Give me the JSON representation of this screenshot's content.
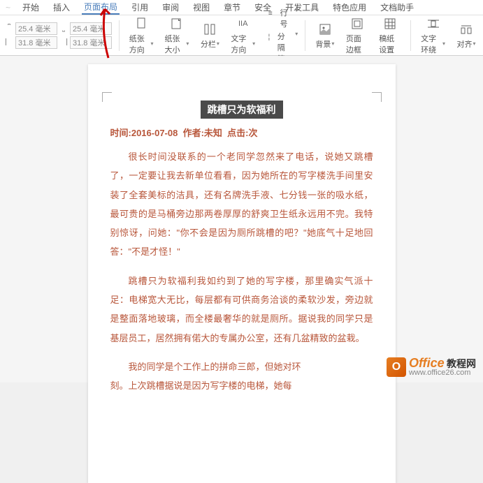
{
  "menu": {
    "items": [
      "开始",
      "插入",
      "页面布局",
      "引用",
      "审阅",
      "视图",
      "章节",
      "安全",
      "开发工具",
      "特色应用",
      "文档助手"
    ],
    "active_index": 2
  },
  "ribbon": {
    "margin_top": "25.4 毫米",
    "margin_bottom": "25.4 毫米",
    "margin_left": "31.8 毫米",
    "margin_right": "31.8 毫米",
    "orientation": "纸张方向",
    "size": "纸张大小",
    "columns": "分栏",
    "text_direction": "文字方向",
    "line_number": "行号",
    "separator": "分隔符",
    "background": "背景",
    "page_border": "页面边框",
    "manuscript": "稿纸设置",
    "text_wrap": "文字环绕",
    "align": "对齐"
  },
  "document": {
    "title": "跳槽只为软福利",
    "meta_time_label": "时间:",
    "meta_time": "2016-07-08",
    "meta_author_label": "作者:",
    "meta_author": "未知",
    "meta_click_label": "点击:",
    "meta_click": "次",
    "para1": "很长时间没联系的一个老同学忽然来了电话，说她又跳槽了，一定要让我去新单位看看，因为她所在的写字楼洗手间里安装了全套美标的洁具，还有名牌洗手液、七分钱一张的吸水纸，最可贵的是马桶旁边那两卷厚厚的舒爽卫生纸永远用不完。我特别惊讶，问她：\"你不会是因为厕所跳槽的吧？\"她底气十足地回答：\"不是才怪！\"",
    "para2": "跳槽只为软福利我如约到了她的写字楼，那里确实气派十足：电梯宽大无比，每层都有可供商务洽谈的柔软沙发，旁边就是整面落地玻璃，而全楼最奢华的就是厕所。据说我的同学只是基层员工，居然拥有偌大的专属办公室，还有几盆精致的盆栽。",
    "para3": "我的同学是个工作上的拼命三郎，但她对环",
    "para3b": "刻。上次跳槽据说是因为写字楼的电梯，她每"
  },
  "watermark": {
    "brand": "Office",
    "brand_suffix": "教程网",
    "url": "www.office26.com"
  }
}
